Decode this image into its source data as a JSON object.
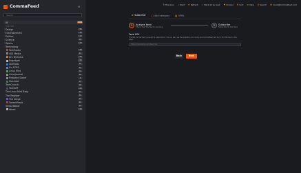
{
  "app": {
    "name": "CommaFeed"
  },
  "sidebar": {
    "search_placeholder": "Search",
    "items": [
      {
        "label": "All",
        "count": "9999",
        "selected": true,
        "icon_color": "",
        "chev": "",
        "hot": true
      },
      {
        "label": "Starred",
        "count": "",
        "muted": true,
        "chev": "",
        "icon_color": ""
      },
      {
        "label": "Design",
        "count": "266",
        "chev": "›",
        "icon_color": ""
      },
      {
        "label": "Entertainment",
        "count": "142",
        "chev": "›",
        "icon_color": ""
      },
      {
        "label": "Politics",
        "count": "112",
        "chev": "›",
        "icon_color": ""
      },
      {
        "label": "Science",
        "count": "96",
        "chev": "›",
        "icon_color": ""
      },
      {
        "label": "Sports",
        "count": "104",
        "chev": "›",
        "icon_color": ""
      },
      {
        "label": "Technology",
        "count": "",
        "chev": "⌄",
        "icon_color": ""
      },
      {
        "label": "TechRadar",
        "count": "196",
        "chev": "",
        "icon_color": "#e03131"
      },
      {
        "label": "404 Media",
        "count": "14",
        "chev": "",
        "icon_color": "#868e96"
      },
      {
        "label": "Ars Technica",
        "count": "200",
        "chev": "",
        "icon_color": "#f76707"
      },
      {
        "label": "Engadget",
        "count": "100",
        "chev": "",
        "icon_color": "#adb5bd"
      },
      {
        "label": "Gizmodo",
        "count": "50",
        "chev": "",
        "icon_color": "#1c7ed6"
      },
      {
        "label": "It's FOSS",
        "count": "20",
        "chev": "",
        "icon_color": "#5c7cfa"
      },
      {
        "label": "Linux Mint",
        "count": "34",
        "chev": "",
        "icon_color": "#37b24d"
      },
      {
        "label": "LinuxJournal",
        "count": "50",
        "chev": "",
        "icon_color": "#868e96"
      },
      {
        "label": "Pinboard Dwarf",
        "count": "6",
        "chev": "",
        "icon_color": "#868e96"
      },
      {
        "label": "Slashdot",
        "count": "15",
        "chev": "",
        "icon_color": "#2b8a3e"
      },
      {
        "label": "TechCrunch",
        "count": "20",
        "chev": "",
        "icon_color": ""
      },
      {
        "label": "TechSRF",
        "count": "100",
        "chev": "",
        "icon_color": "#495057"
      },
      {
        "label": "The Linux Mint Blog",
        "count": "10",
        "chev": "",
        "icon_color": ""
      },
      {
        "label": "The Register",
        "count": "50",
        "chev": "",
        "icon_color": ""
      },
      {
        "label": "The Verge",
        "count": "10",
        "chev": "",
        "icon_color": "#7048e8"
      },
      {
        "label": "TorrentFreak",
        "count": "10",
        "chev": "",
        "icon_color": "#e03131"
      },
      {
        "label": "VentureBeat",
        "count": "20",
        "chev": "",
        "icon_color": ""
      },
      {
        "label": "Wired",
        "count": "100",
        "chev": "",
        "icon_color": "#adb5bd"
      }
    ]
  },
  "topbar": {
    "items": [
      {
        "icon": "↻",
        "label": "Previous"
      },
      {
        "icon": "↓",
        "label": "Next"
      },
      {
        "icon": "⟳",
        "label": "Refresh"
      },
      {
        "icon": "✓",
        "label": "Mark all as read"
      },
      {
        "icon": "⚑",
        "label": "Unread"
      },
      {
        "icon": "⇅",
        "label": "Sort"
      },
      {
        "icon": "≡",
        "label": "View"
      },
      {
        "icon": "⚲",
        "label": "Search"
      },
      {
        "icon": "⚙",
        "label": "mock@commafeed.com"
      }
    ]
  },
  "tabs": {
    "subscribe": "Subscribe",
    "add_category": "Add category",
    "opml": "OPML"
  },
  "stepper": {
    "step1_num": "1",
    "step1_title": "Analyze feed",
    "step1_desc": "Check that the feed is working",
    "step2_num": "2",
    "step2_title": "Subscribe",
    "step2_desc": "Subscribe to the feed"
  },
  "form": {
    "label": "Feed URL",
    "desc": "The URL for the feed you want to subscribe to. You can also use the website's url directly and CommaFeed will try to find the feed in the page.",
    "placeholder": "https://example.com/feed.rss"
  },
  "buttons": {
    "back": "Back",
    "next": "Next"
  },
  "colors": {
    "accent": "#e8590c",
    "background": "#1a1b1e",
    "sidebar": "#25262b"
  }
}
